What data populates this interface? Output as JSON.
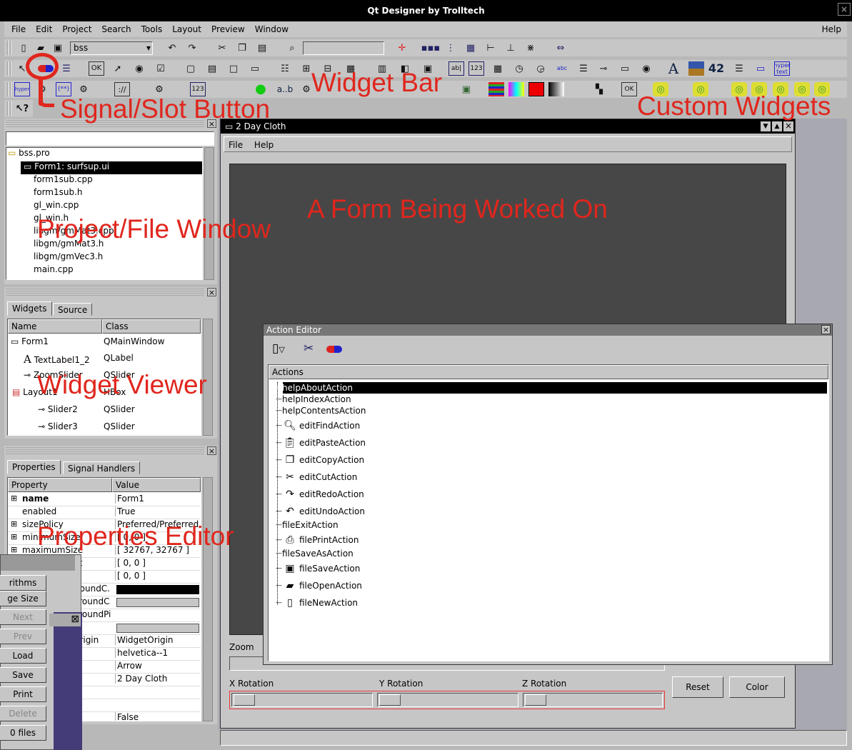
{
  "window": {
    "title": "Qt Designer by Trolltech"
  },
  "menubar": {
    "items": [
      "File",
      "Edit",
      "Project",
      "Search",
      "Tools",
      "Layout",
      "Preview",
      "Window"
    ],
    "help": "Help"
  },
  "toolbar": {
    "project_combo": "bss",
    "search_placeholder": ""
  },
  "annotations": {
    "signal_slot": "Signal/Slot Button",
    "widget_bar": "Widget Bar",
    "custom_widgets": "Custom Widgets",
    "project_window": "Project/File Window",
    "form": "A Form Being Worked On",
    "widget_viewer": "Widget Viewer",
    "properties_editor": "Properties Editor"
  },
  "widgetbar": {
    "label_ab": "a..b",
    "num1": "123",
    "num2": "42",
    "hyper": "hyper text"
  },
  "project": {
    "root": "bss.pro",
    "items": [
      "Form1: surfsup.ui",
      "form1sub.cpp",
      "form1sub.h",
      "gl_win.cpp",
      "gl_win.h",
      "libgm/gmMat3.cpp",
      "libgm/gmMat3.h",
      "libgm/gmVec3.h",
      "main.cpp"
    ]
  },
  "widgetviewer": {
    "tabs": [
      "Widgets",
      "Source"
    ],
    "headers": [
      "Name",
      "Class"
    ],
    "rows": [
      {
        "name": "Form1",
        "cls": "QMainWindow"
      },
      {
        "name": "TextLabel1_2",
        "cls": "QLabel"
      },
      {
        "name": "ZoomSlider",
        "cls": "QSlider"
      },
      {
        "name": "Layout1",
        "cls": "HBox"
      },
      {
        "name": "Slider2",
        "cls": "QSlider"
      },
      {
        "name": "Slider3",
        "cls": "QSlider"
      }
    ]
  },
  "properties": {
    "tabs": [
      "Properties",
      "Signal Handlers"
    ],
    "headers": [
      "Property",
      "Value"
    ],
    "rows": [
      {
        "p": "name",
        "v": "Form1"
      },
      {
        "p": "enabled",
        "v": "True"
      },
      {
        "p": "sizePolicy",
        "v": "Preferred/Preferred/..."
      },
      {
        "p": "minimumSize",
        "v": "[ 0, 0 ]"
      },
      {
        "p": "maximumSize",
        "v": "[ 32767, 32767 ]"
      },
      {
        "p": "sizeIncrement",
        "v": "[ 0, 0 ]"
      },
      {
        "p": "baseSize",
        "v": "[ 0, 0 ]"
      },
      {
        "p": "paletteForegroundC...",
        "v": ""
      },
      {
        "p": "paletteBackgroundC...",
        "v": ""
      },
      {
        "p": "paletteBackgroundPi...",
        "v": ""
      },
      {
        "p": "",
        "v": ""
      },
      {
        "p": "backgroundOrigin",
        "v": "WidgetOrigin"
      },
      {
        "p": "font",
        "v": "helvetica--1"
      },
      {
        "p": "cursor",
        "v": "Arrow"
      },
      {
        "p": "caption",
        "v": "2 Day Cloth"
      },
      {
        "p": "",
        "v": ""
      },
      {
        "p": "",
        "v": ""
      },
      {
        "p": "",
        "v": "False"
      }
    ]
  },
  "leftpanel": {
    "items": [
      "rithms",
      "ge Size",
      "Next",
      "Prev",
      "Load",
      "Save",
      "Print",
      "Delete",
      "0 files"
    ]
  },
  "form": {
    "title": "2 Day Cloth",
    "menu": [
      "File",
      "Help"
    ],
    "zoom": "Zoom",
    "x": "X Rotation",
    "y": "Y Rotation",
    "z": "Z Rotation",
    "reset": "Reset",
    "color": "Color"
  },
  "actioneditor": {
    "title": "Action Editor",
    "header": "Actions",
    "items": [
      "helpAboutAction",
      "helpIndexAction",
      "helpContentsAction",
      "editFindAction",
      "editPasteAction",
      "editCopyAction",
      "editCutAction",
      "editRedoAction",
      "editUndoAction",
      "fileExitAction",
      "filePrintAction",
      "fileSaveAsAction",
      "fileSaveAction",
      "fileOpenAction",
      "fileNewAction"
    ],
    "icons": [
      "",
      "",
      "",
      "magnifier-icon",
      "paste-icon",
      "copy-icon",
      "scissors-icon",
      "redo-icon",
      "undo-icon",
      "",
      "printer-icon",
      "",
      "floppy-icon",
      "open-folder-icon",
      "new-file-icon"
    ]
  },
  "colors": {
    "titlebar": "#000000",
    "selection": "#000000",
    "overlay": "#e0261d",
    "canvas": "#474747"
  }
}
